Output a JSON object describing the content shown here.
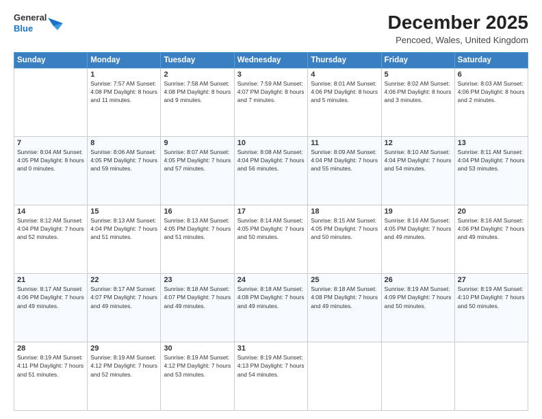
{
  "header": {
    "logo_line1": "General",
    "logo_line2": "Blue",
    "main_title": "December 2025",
    "subtitle": "Pencoed, Wales, United Kingdom"
  },
  "days_of_week": [
    "Sunday",
    "Monday",
    "Tuesday",
    "Wednesday",
    "Thursday",
    "Friday",
    "Saturday"
  ],
  "weeks": [
    [
      {
        "day": "",
        "info": ""
      },
      {
        "day": "1",
        "info": "Sunrise: 7:57 AM\nSunset: 4:08 PM\nDaylight: 8 hours\nand 11 minutes."
      },
      {
        "day": "2",
        "info": "Sunrise: 7:58 AM\nSunset: 4:08 PM\nDaylight: 8 hours\nand 9 minutes."
      },
      {
        "day": "3",
        "info": "Sunrise: 7:59 AM\nSunset: 4:07 PM\nDaylight: 8 hours\nand 7 minutes."
      },
      {
        "day": "4",
        "info": "Sunrise: 8:01 AM\nSunset: 4:06 PM\nDaylight: 8 hours\nand 5 minutes."
      },
      {
        "day": "5",
        "info": "Sunrise: 8:02 AM\nSunset: 4:06 PM\nDaylight: 8 hours\nand 3 minutes."
      },
      {
        "day": "6",
        "info": "Sunrise: 8:03 AM\nSunset: 4:06 PM\nDaylight: 8 hours\nand 2 minutes."
      }
    ],
    [
      {
        "day": "7",
        "info": "Sunrise: 8:04 AM\nSunset: 4:05 PM\nDaylight: 8 hours\nand 0 minutes."
      },
      {
        "day": "8",
        "info": "Sunrise: 8:06 AM\nSunset: 4:05 PM\nDaylight: 7 hours\nand 59 minutes."
      },
      {
        "day": "9",
        "info": "Sunrise: 8:07 AM\nSunset: 4:05 PM\nDaylight: 7 hours\nand 57 minutes."
      },
      {
        "day": "10",
        "info": "Sunrise: 8:08 AM\nSunset: 4:04 PM\nDaylight: 7 hours\nand 56 minutes."
      },
      {
        "day": "11",
        "info": "Sunrise: 8:09 AM\nSunset: 4:04 PM\nDaylight: 7 hours\nand 55 minutes."
      },
      {
        "day": "12",
        "info": "Sunrise: 8:10 AM\nSunset: 4:04 PM\nDaylight: 7 hours\nand 54 minutes."
      },
      {
        "day": "13",
        "info": "Sunrise: 8:11 AM\nSunset: 4:04 PM\nDaylight: 7 hours\nand 53 minutes."
      }
    ],
    [
      {
        "day": "14",
        "info": "Sunrise: 8:12 AM\nSunset: 4:04 PM\nDaylight: 7 hours\nand 52 minutes."
      },
      {
        "day": "15",
        "info": "Sunrise: 8:13 AM\nSunset: 4:04 PM\nDaylight: 7 hours\nand 51 minutes."
      },
      {
        "day": "16",
        "info": "Sunrise: 8:13 AM\nSunset: 4:05 PM\nDaylight: 7 hours\nand 51 minutes."
      },
      {
        "day": "17",
        "info": "Sunrise: 8:14 AM\nSunset: 4:05 PM\nDaylight: 7 hours\nand 50 minutes."
      },
      {
        "day": "18",
        "info": "Sunrise: 8:15 AM\nSunset: 4:05 PM\nDaylight: 7 hours\nand 50 minutes."
      },
      {
        "day": "19",
        "info": "Sunrise: 8:16 AM\nSunset: 4:05 PM\nDaylight: 7 hours\nand 49 minutes."
      },
      {
        "day": "20",
        "info": "Sunrise: 8:16 AM\nSunset: 4:06 PM\nDaylight: 7 hours\nand 49 minutes."
      }
    ],
    [
      {
        "day": "21",
        "info": "Sunrise: 8:17 AM\nSunset: 4:06 PM\nDaylight: 7 hours\nand 49 minutes."
      },
      {
        "day": "22",
        "info": "Sunrise: 8:17 AM\nSunset: 4:07 PM\nDaylight: 7 hours\nand 49 minutes."
      },
      {
        "day": "23",
        "info": "Sunrise: 8:18 AM\nSunset: 4:07 PM\nDaylight: 7 hours\nand 49 minutes."
      },
      {
        "day": "24",
        "info": "Sunrise: 8:18 AM\nSunset: 4:08 PM\nDaylight: 7 hours\nand 49 minutes."
      },
      {
        "day": "25",
        "info": "Sunrise: 8:18 AM\nSunset: 4:08 PM\nDaylight: 7 hours\nand 49 minutes."
      },
      {
        "day": "26",
        "info": "Sunrise: 8:19 AM\nSunset: 4:09 PM\nDaylight: 7 hours\nand 50 minutes."
      },
      {
        "day": "27",
        "info": "Sunrise: 8:19 AM\nSunset: 4:10 PM\nDaylight: 7 hours\nand 50 minutes."
      }
    ],
    [
      {
        "day": "28",
        "info": "Sunrise: 8:19 AM\nSunset: 4:11 PM\nDaylight: 7 hours\nand 51 minutes."
      },
      {
        "day": "29",
        "info": "Sunrise: 8:19 AM\nSunset: 4:12 PM\nDaylight: 7 hours\nand 52 minutes."
      },
      {
        "day": "30",
        "info": "Sunrise: 8:19 AM\nSunset: 4:12 PM\nDaylight: 7 hours\nand 53 minutes."
      },
      {
        "day": "31",
        "info": "Sunrise: 8:19 AM\nSunset: 4:13 PM\nDaylight: 7 hours\nand 54 minutes."
      },
      {
        "day": "",
        "info": ""
      },
      {
        "day": "",
        "info": ""
      },
      {
        "day": "",
        "info": ""
      }
    ]
  ]
}
